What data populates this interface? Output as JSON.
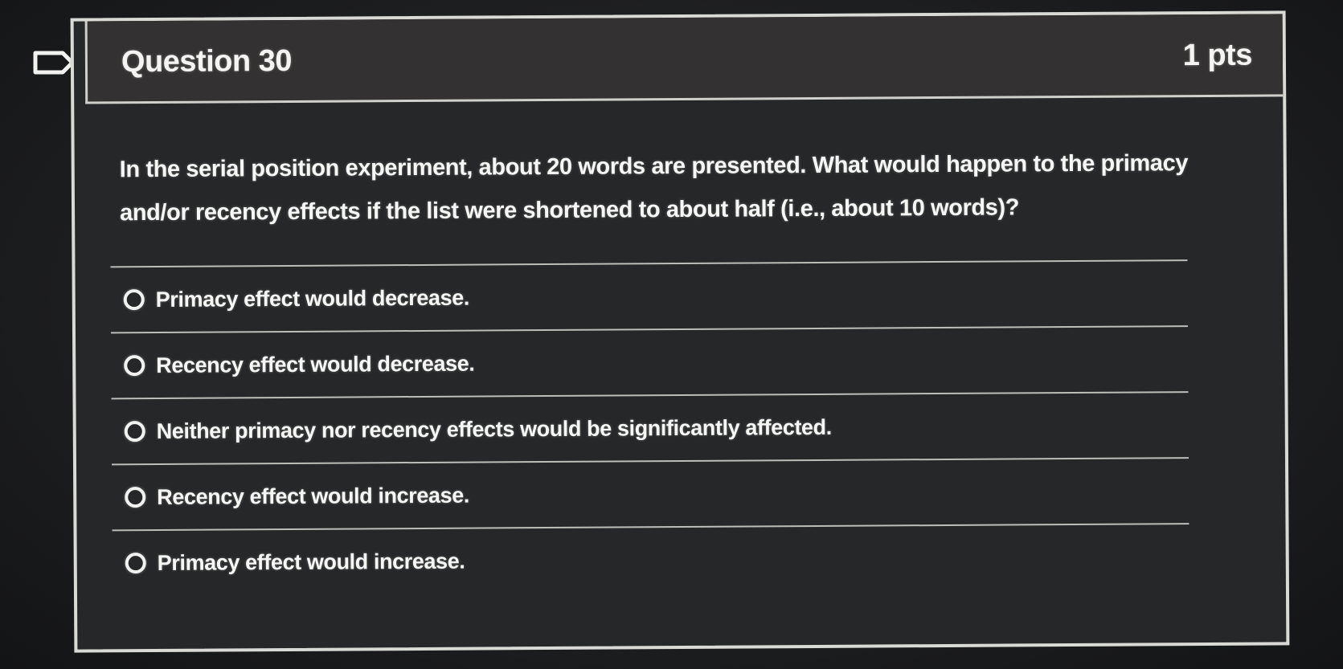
{
  "question": {
    "title": "Question 30",
    "points": "1 pts",
    "text": "In the serial position experiment, about 20 words are presented. What would happen to the primacy and/or recency effects if the list were shortened to about half (i.e., about 10 words)?"
  },
  "answers": [
    {
      "label": "Primacy effect would decrease.",
      "selected": false
    },
    {
      "label": "Recency effect would decrease.",
      "selected": false
    },
    {
      "label": "Neither primacy nor recency effects would be significantly affected.",
      "selected": false
    },
    {
      "label": "Recency effect would increase.",
      "selected": false
    },
    {
      "label": "Primacy effect would increase.",
      "selected": false
    }
  ],
  "flag_icon": "flag-icon",
  "colors": {
    "background": "#1d1e20",
    "card": "#262729",
    "header": "#333131",
    "text": "#f6f6f4",
    "border": "#d9d9d6"
  }
}
